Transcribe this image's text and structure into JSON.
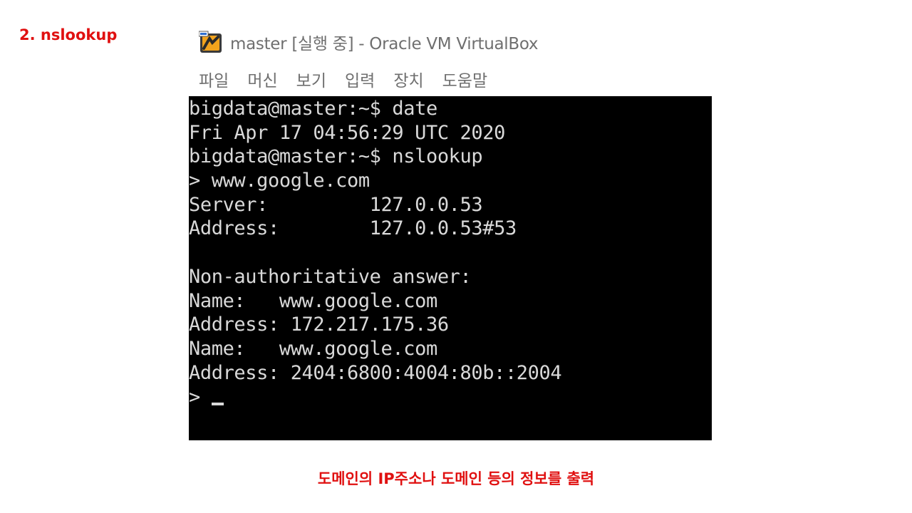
{
  "slide": {
    "heading": "2. nslookup",
    "caption": "도메인의 IP주소나 도메인 등의 정보를 출력",
    "accent_color": "#e01010"
  },
  "window": {
    "title": "master [실행 중] - Oracle VM VirtualBox",
    "icon": "virtualbox-app-icon",
    "menu": [
      "파일",
      "머신",
      "보기",
      "입력",
      "장치",
      "도움말"
    ]
  },
  "console": {
    "background": "#000000",
    "foreground": "#d9d9d9",
    "lines": [
      "bigdata@master:~$ date",
      "Fri Apr 17 04:56:29 UTC 2020",
      "bigdata@master:~$ nslookup",
      "> www.google.com",
      "Server:         127.0.0.53",
      "Address:        127.0.0.53#53",
      "",
      "Non-authoritative answer:",
      "Name:   www.google.com",
      "Address: 172.217.175.36",
      "Name:   www.google.com",
      "Address: 2404:6800:4004:80b::2004",
      "> "
    ]
  }
}
